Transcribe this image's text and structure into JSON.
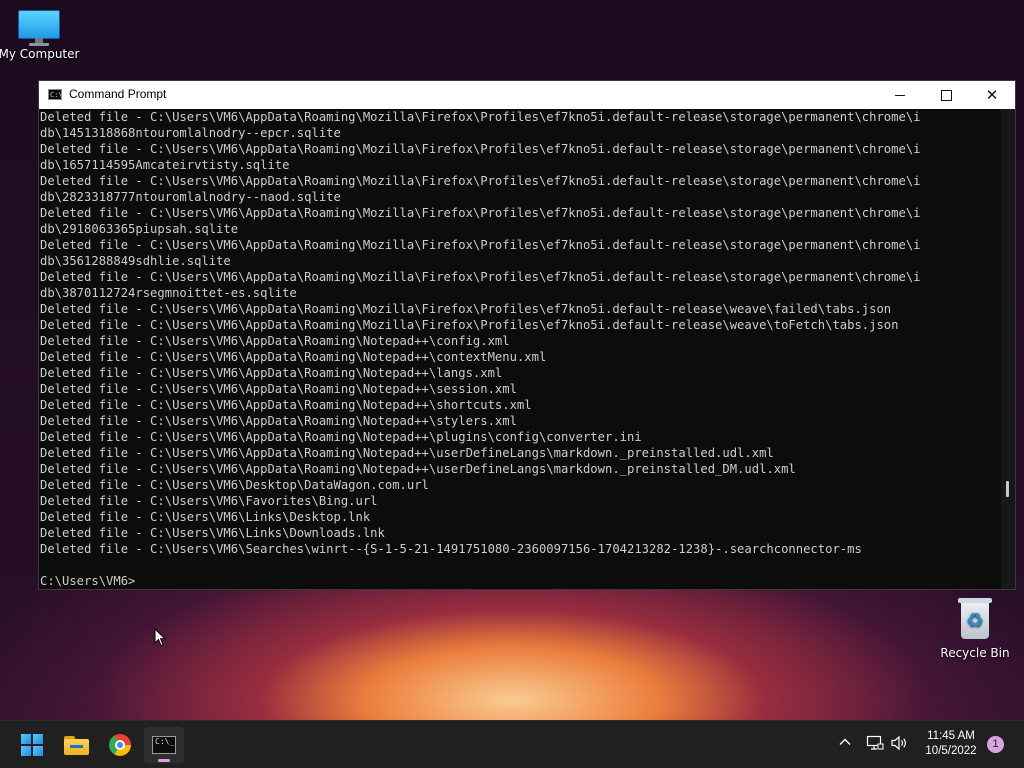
{
  "desktop": {
    "icons": [
      {
        "label": "My Computer",
        "icon": "monitor-icon"
      },
      {
        "label": "Recycle Bin",
        "icon": "recycle-bin-icon"
      }
    ]
  },
  "window": {
    "title": "Command Prompt",
    "icon": "console-icon",
    "lines": [
      "Deleted file - C:\\Users\\VM6\\AppData\\Roaming\\Mozilla\\Firefox\\Profiles\\ef7kno5i.default-release\\storage\\permanent\\chrome\\i",
      "db\\1451318868ntouromlalnodry--epcr.sqlite",
      "Deleted file - C:\\Users\\VM6\\AppData\\Roaming\\Mozilla\\Firefox\\Profiles\\ef7kno5i.default-release\\storage\\permanent\\chrome\\i",
      "db\\1657114595Amcateirvtisty.sqlite",
      "Deleted file - C:\\Users\\VM6\\AppData\\Roaming\\Mozilla\\Firefox\\Profiles\\ef7kno5i.default-release\\storage\\permanent\\chrome\\i",
      "db\\2823318777ntouromlalnodry--naod.sqlite",
      "Deleted file - C:\\Users\\VM6\\AppData\\Roaming\\Mozilla\\Firefox\\Profiles\\ef7kno5i.default-release\\storage\\permanent\\chrome\\i",
      "db\\2918063365piupsah.sqlite",
      "Deleted file - C:\\Users\\VM6\\AppData\\Roaming\\Mozilla\\Firefox\\Profiles\\ef7kno5i.default-release\\storage\\permanent\\chrome\\i",
      "db\\3561288849sdhlie.sqlite",
      "Deleted file - C:\\Users\\VM6\\AppData\\Roaming\\Mozilla\\Firefox\\Profiles\\ef7kno5i.default-release\\storage\\permanent\\chrome\\i",
      "db\\3870112724rsegmnoittet-es.sqlite",
      "Deleted file - C:\\Users\\VM6\\AppData\\Roaming\\Mozilla\\Firefox\\Profiles\\ef7kno5i.default-release\\weave\\failed\\tabs.json",
      "Deleted file - C:\\Users\\VM6\\AppData\\Roaming\\Mozilla\\Firefox\\Profiles\\ef7kno5i.default-release\\weave\\toFetch\\tabs.json",
      "Deleted file - C:\\Users\\VM6\\AppData\\Roaming\\Notepad++\\config.xml",
      "Deleted file - C:\\Users\\VM6\\AppData\\Roaming\\Notepad++\\contextMenu.xml",
      "Deleted file - C:\\Users\\VM6\\AppData\\Roaming\\Notepad++\\langs.xml",
      "Deleted file - C:\\Users\\VM6\\AppData\\Roaming\\Notepad++\\session.xml",
      "Deleted file - C:\\Users\\VM6\\AppData\\Roaming\\Notepad++\\shortcuts.xml",
      "Deleted file - C:\\Users\\VM6\\AppData\\Roaming\\Notepad++\\stylers.xml",
      "Deleted file - C:\\Users\\VM6\\AppData\\Roaming\\Notepad++\\plugins\\config\\converter.ini",
      "Deleted file - C:\\Users\\VM6\\AppData\\Roaming\\Notepad++\\userDefineLangs\\markdown._preinstalled.udl.xml",
      "Deleted file - C:\\Users\\VM6\\AppData\\Roaming\\Notepad++\\userDefineLangs\\markdown._preinstalled_DM.udl.xml",
      "Deleted file - C:\\Users\\VM6\\Desktop\\DataWagon.com.url",
      "Deleted file - C:\\Users\\VM6\\Favorites\\Bing.url",
      "Deleted file - C:\\Users\\VM6\\Links\\Desktop.lnk",
      "Deleted file - C:\\Users\\VM6\\Links\\Downloads.lnk",
      "Deleted file - C:\\Users\\VM6\\Searches\\winrt--{S-1-5-21-1491751080-2360097156-1704213282-1238}-.searchconnector-ms",
      "",
      "C:\\Users\\VM6>"
    ]
  },
  "taskbar": {
    "items": [
      {
        "name": "start",
        "icon": "windows-start-icon"
      },
      {
        "name": "file-explorer",
        "icon": "folder-icon"
      },
      {
        "name": "chrome",
        "icon": "chrome-icon"
      },
      {
        "name": "command-prompt",
        "icon": "console-icon",
        "active": true
      }
    ],
    "tray": {
      "time": "11:45 AM",
      "date": "10/5/2022",
      "notification_count": "1"
    }
  },
  "colors": {
    "console_bg": "#0c0c0c",
    "console_text": "#cccccc",
    "taskbar_bg": "#202020",
    "active_indicator": "#e49ad8"
  }
}
